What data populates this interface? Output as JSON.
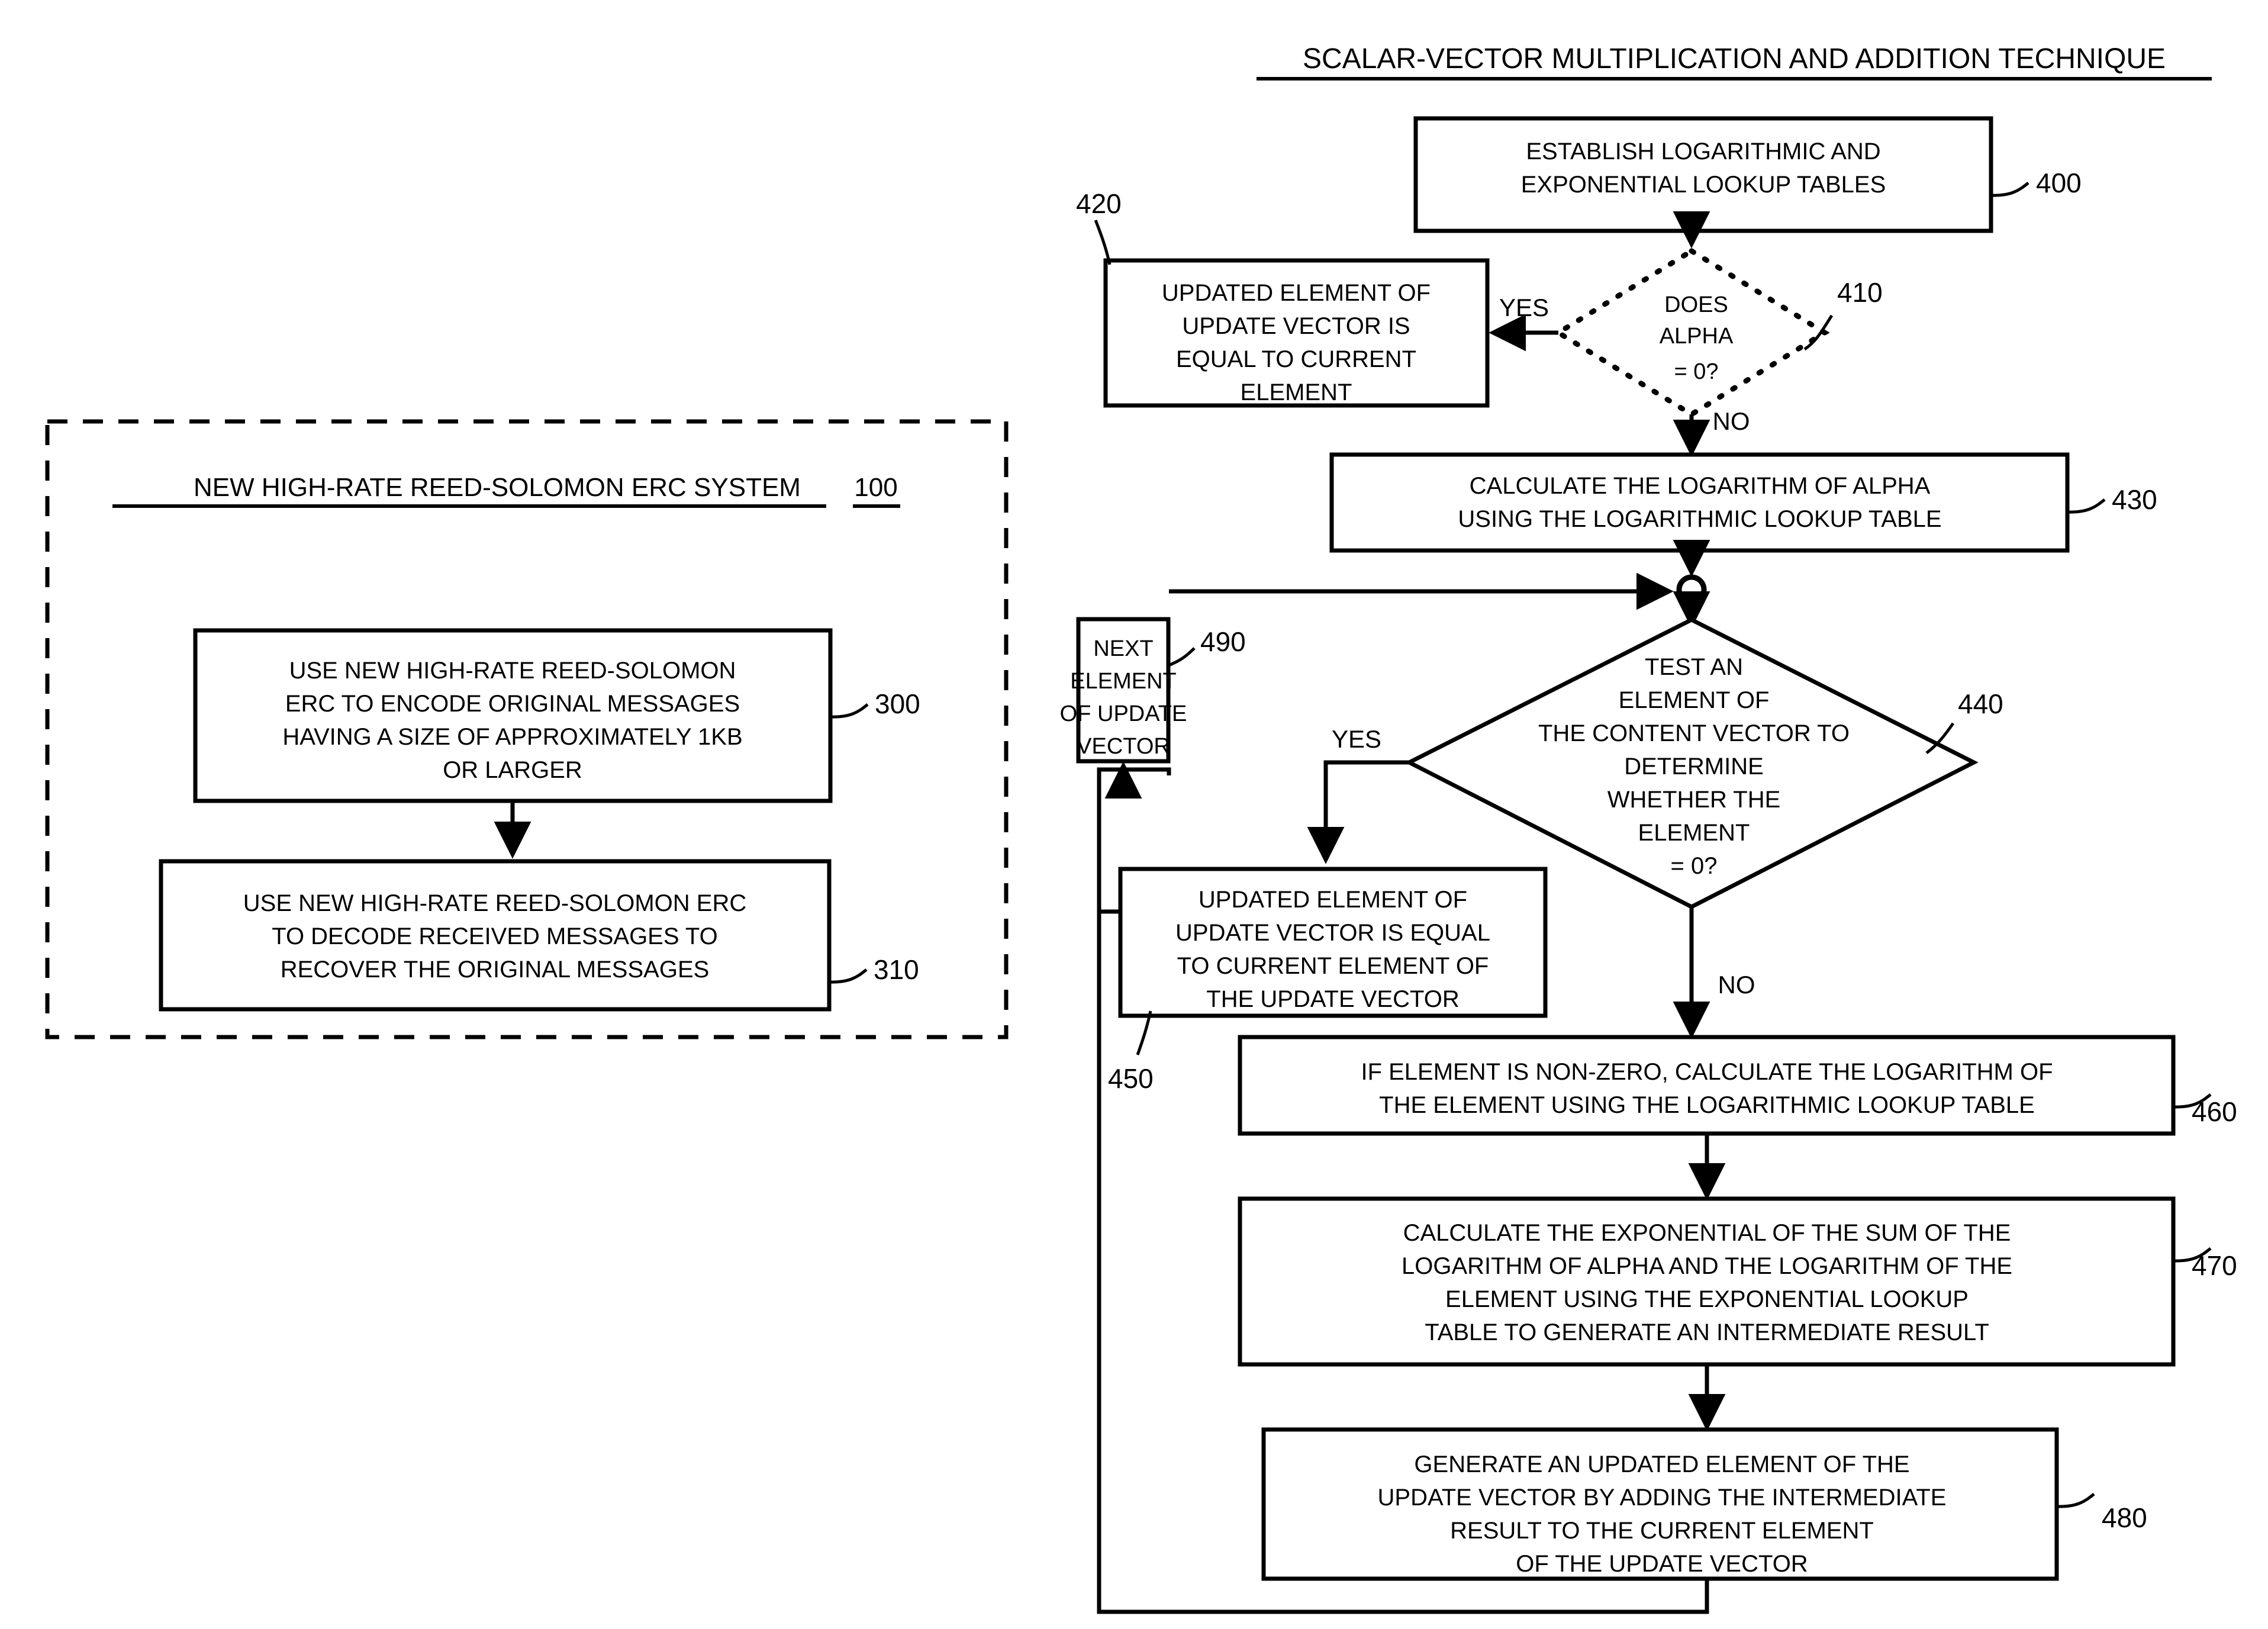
{
  "figure": {
    "title": "SCALAR-VECTOR MULTIPLICATION AND ADDITION TECHNIQUE"
  },
  "system_panel": {
    "title": "NEW HIGH-RATE REED-SOLOMON ERC SYSTEM",
    "ref": "100",
    "boxes": [
      {
        "ref": "300",
        "lines": [
          "USE NEW HIGH-RATE REED-SOLOMON",
          "ERC TO ENCODE ORIGINAL MESSAGES",
          "HAVING A SIZE OF APPROXIMATELY 1KB",
          "OR LARGER"
        ]
      },
      {
        "ref": "310",
        "lines": [
          "USE NEW HIGH-RATE REED-SOLOMON ERC",
          "TO DECODE RECEIVED MESSAGES TO",
          "RECOVER THE ORIGINAL MESSAGES"
        ]
      }
    ]
  },
  "flow": {
    "nodes": [
      {
        "ref": "400",
        "type": "process",
        "lines": [
          "ESTABLISH LOGARITHMIC AND",
          "EXPONENTIAL LOOKUP TABLES"
        ]
      },
      {
        "ref": "410",
        "type": "decision-dotted",
        "lines": [
          "DOES",
          "ALPHA",
          "= 0?"
        ]
      },
      {
        "ref": "420",
        "type": "process",
        "lines": [
          "UPDATED ELEMENT OF",
          "UPDATE VECTOR IS",
          "EQUAL TO CURRENT",
          "ELEMENT"
        ]
      },
      {
        "ref": "430",
        "type": "process",
        "lines": [
          "CALCULATE THE LOGARITHM OF ALPHA",
          "USING THE LOGARITHMIC LOOKUP TABLE"
        ]
      },
      {
        "ref": "440",
        "type": "decision",
        "lines": [
          "TEST AN",
          "ELEMENT OF",
          "THE CONTENT VECTOR TO",
          "DETERMINE",
          "WHETHER THE",
          "ELEMENT",
          "= 0?"
        ]
      },
      {
        "ref": "450",
        "type": "process",
        "lines": [
          "UPDATED ELEMENT OF",
          "UPDATE VECTOR IS EQUAL",
          "TO CURRENT ELEMENT OF",
          "THE UPDATE VECTOR"
        ]
      },
      {
        "ref": "460",
        "type": "process",
        "lines": [
          "IF ELEMENT IS NON-ZERO, CALCULATE THE LOGARITHM OF",
          "THE ELEMENT USING THE LOGARITHMIC LOOKUP TABLE"
        ]
      },
      {
        "ref": "470",
        "type": "process",
        "lines": [
          "CALCULATE THE EXPONENTIAL OF THE SUM OF THE",
          "LOGARITHM OF ALPHA AND THE LOGARITHM OF THE",
          "ELEMENT USING THE EXPONENTIAL LOOKUP",
          "TABLE TO GENERATE AN INTERMEDIATE RESULT"
        ]
      },
      {
        "ref": "480",
        "type": "process",
        "lines": [
          "GENERATE AN UPDATED ELEMENT OF THE",
          "UPDATE VECTOR BY ADDING THE INTERMEDIATE",
          "RESULT TO THE CURRENT ELEMENT",
          "OF THE UPDATE VECTOR"
        ]
      },
      {
        "ref": "490",
        "type": "process",
        "lines": [
          "NEXT",
          "ELEMENT",
          "OF UPDATE",
          "VECTOR"
        ]
      }
    ],
    "edge_labels": {
      "yes_alpha": "YES",
      "no_alpha": "NO",
      "yes_element": "YES",
      "no_element": "NO"
    }
  }
}
